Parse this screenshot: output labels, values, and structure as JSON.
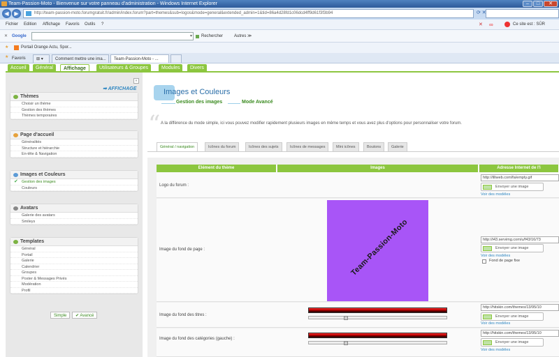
{
  "window": {
    "title": "Team-Passion-Moto - Bienvenue sur votre panneau d'administration - Windows Internet Explorer",
    "address": "http://team-passion-moto.forumgratuit.fr/admin/index.forum?part=themes&sub=logos&mode=general&extended_admin=1&tid=86a4d28fd1c06dcd4ff9d61f3f3b94",
    "address_domain": "forumgratuit.fr",
    "site_status": "Ce site est : SÛR"
  },
  "menu": [
    "Fichier",
    "Edition",
    "Affichage",
    "Favoris",
    "Outils",
    "?"
  ],
  "google": {
    "logo": "Google",
    "search_label": "Rechercher",
    "others_label": "Autres ≫"
  },
  "favorites": {
    "label": "Favoris",
    "link": "Portail Orange  Actu, Spor..."
  },
  "browser_tabs": [
    "Comment mettre une ima...",
    "Team-Passion-Moto - ..."
  ],
  "admin_tabs": [
    "Accueil",
    "Général",
    "Affichage",
    "Utilisateurs & Groupes",
    "Modules",
    "Divers"
  ],
  "sidebar": {
    "section_title": "AFFICHAGE",
    "sections": [
      {
        "title": "Thèmes",
        "items": [
          "Choisir un thème",
          "Gestion des thèmes",
          "Thèmes temporaires"
        ]
      },
      {
        "title": "Page d'accueil",
        "items": [
          "Généralités",
          "Structure et hiérarchie",
          "En-tête & Navigation"
        ]
      },
      {
        "title": "Images et Couleurs",
        "items": [
          "Gestion des images",
          "Couleurs"
        ]
      },
      {
        "title": "Avatars",
        "items": [
          "Galerie des avatars",
          "Smileys"
        ]
      },
      {
        "title": "Templates",
        "items": [
          "Général",
          "Portail",
          "Galerie",
          "Calendrier",
          "Groupes",
          "Poster & Messages Privés",
          "Modération",
          "Profil"
        ]
      }
    ],
    "simple_button": "Simple",
    "advanced_button": "Avancé"
  },
  "main": {
    "title": "Images et Couleurs",
    "step1": "Gestion des images",
    "step2": "Mode Avancé",
    "description": "A la différence du mode simple,  ici vous pouvez modifier rapidement plusieurs images en même temps et vous avez plus d'options pour personnaliser votre forum.",
    "tabs": [
      "Général / navigation",
      "Icônes du forum",
      "Icônes des sujets",
      "Icônes de messages",
      "Mini icônes",
      "Boutons",
      "Galerie"
    ],
    "columns": [
      "Elément du thème",
      "Images",
      "Adresse Internet de l'i"
    ],
    "rows": [
      {
        "label": "Logo du forum :",
        "url": "http://illiweb.com/fa/empty.gif"
      },
      {
        "label": "Image du fond de page :",
        "url": "http://i43.servimg.com/u/f43/16/73",
        "extra": "Fond de page fixe"
      },
      {
        "label": "Image du fond des titres :",
        "url": "http://hitskin.com/themes/13/95/10"
      },
      {
        "label": "Image du fond des catégories (gauche) :",
        "url": "http://hitskin.com/themes/13/95/10"
      }
    ],
    "upload_label": "Envoyer une image",
    "models_label": "Voir des modèles",
    "preview_text": "Team-Passion-Moto"
  }
}
